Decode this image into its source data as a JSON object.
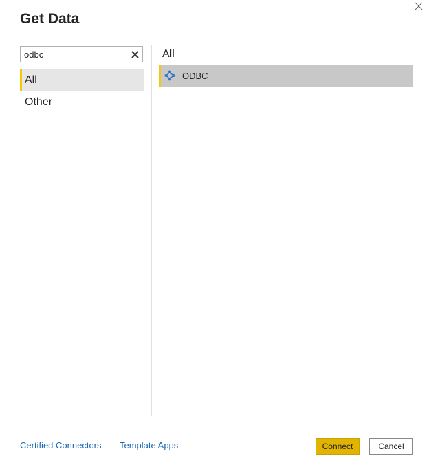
{
  "dialog": {
    "title": "Get Data",
    "close_icon": "close-icon"
  },
  "search": {
    "value": "odbc",
    "clear_icon": "clear-icon"
  },
  "categories": [
    {
      "label": "All",
      "selected": true
    },
    {
      "label": "Other",
      "selected": false
    }
  ],
  "results": {
    "header": "All",
    "items": [
      {
        "label": "ODBC",
        "icon": "odbc-connector-icon",
        "selected": true
      }
    ]
  },
  "footer": {
    "certified_connectors": "Certified Connectors",
    "template_apps": "Template Apps",
    "connect_label": "Connect",
    "cancel_label": "Cancel"
  },
  "colors": {
    "accent": "#f2c811",
    "connect_button": "#e0b400",
    "link": "#1a69b8",
    "selected_category_bg": "#e6e6e6",
    "selected_result_bg": "#c8c8c8",
    "icon_blue": "#2f75c6"
  }
}
